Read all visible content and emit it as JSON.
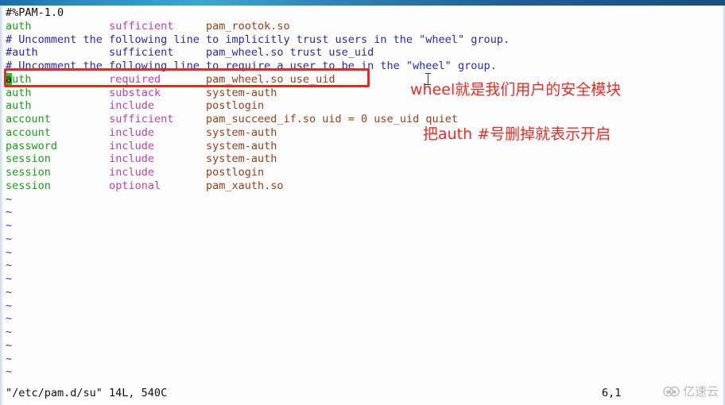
{
  "window": {
    "titlebar_color": "#1f5f96",
    "background": "#fdfdfd"
  },
  "editor": {
    "name": "vim",
    "colors": {
      "directive": "#18a018",
      "control": "#c03fb0",
      "module": "#9a4018",
      "comment": "#2a2ab0",
      "plain": "#101010",
      "tilde": "#3838b8",
      "cursor_bg": "#1ec81e",
      "annotation": "#ef2b22"
    },
    "lines": [
      {
        "segments": [
          {
            "text": "#%PAM-1.0",
            "cls": "c-black"
          }
        ]
      },
      {
        "segments": [
          {
            "text": "auth",
            "cls": "c-green"
          },
          {
            "text": "            ",
            "cls": "c-black"
          },
          {
            "text": "sufficient",
            "cls": "c-magenta"
          },
          {
            "text": "     ",
            "cls": "c-black"
          },
          {
            "text": "pam_rootok.so",
            "cls": "c-brown"
          }
        ]
      },
      {
        "segments": [
          {
            "text": "# Uncomment the following line to implicitly trust users in the \"wheel\" group.",
            "cls": "c-blue"
          }
        ]
      },
      {
        "segments": [
          {
            "text": "#auth",
            "cls": "c-blue"
          },
          {
            "text": "           ",
            "cls": "c-black"
          },
          {
            "text": "sufficient",
            "cls": "c-blue"
          },
          {
            "text": "     ",
            "cls": "c-black"
          },
          {
            "text": "pam_wheel.so trust use_uid",
            "cls": "c-blue"
          }
        ]
      },
      {
        "segments": [
          {
            "text": "# Uncomment the following line to require a user to be in the \"wheel\" group.",
            "cls": "c-blue"
          }
        ]
      },
      {
        "segments": [
          {
            "text": "a",
            "cls": "cursor"
          },
          {
            "text": "uth",
            "cls": "c-green"
          },
          {
            "text": "            ",
            "cls": "c-black"
          },
          {
            "text": "required",
            "cls": "c-magenta"
          },
          {
            "text": "       ",
            "cls": "c-black"
          },
          {
            "text": "pam_wheel.so use_uid",
            "cls": "c-brown"
          }
        ]
      },
      {
        "segments": [
          {
            "text": "auth",
            "cls": "c-green"
          },
          {
            "text": "            ",
            "cls": "c-black"
          },
          {
            "text": "substack",
            "cls": "c-magenta"
          },
          {
            "text": "       ",
            "cls": "c-black"
          },
          {
            "text": "system-auth",
            "cls": "c-brown"
          }
        ]
      },
      {
        "segments": [
          {
            "text": "auth",
            "cls": "c-green"
          },
          {
            "text": "            ",
            "cls": "c-black"
          },
          {
            "text": "include",
            "cls": "c-magenta"
          },
          {
            "text": "        ",
            "cls": "c-black"
          },
          {
            "text": "postlogin",
            "cls": "c-brown"
          }
        ]
      },
      {
        "segments": [
          {
            "text": "account",
            "cls": "c-green"
          },
          {
            "text": "         ",
            "cls": "c-black"
          },
          {
            "text": "sufficient",
            "cls": "c-magenta"
          },
          {
            "text": "     ",
            "cls": "c-black"
          },
          {
            "text": "pam_succeed_if.so uid = 0 use_uid quiet",
            "cls": "c-brown"
          }
        ]
      },
      {
        "segments": [
          {
            "text": "account",
            "cls": "c-green"
          },
          {
            "text": "         ",
            "cls": "c-black"
          },
          {
            "text": "include",
            "cls": "c-magenta"
          },
          {
            "text": "        ",
            "cls": "c-black"
          },
          {
            "text": "system-auth",
            "cls": "c-brown"
          }
        ]
      },
      {
        "segments": [
          {
            "text": "password",
            "cls": "c-green"
          },
          {
            "text": "        ",
            "cls": "c-black"
          },
          {
            "text": "include",
            "cls": "c-magenta"
          },
          {
            "text": "        ",
            "cls": "c-black"
          },
          {
            "text": "system-auth",
            "cls": "c-brown"
          }
        ]
      },
      {
        "segments": [
          {
            "text": "session",
            "cls": "c-green"
          },
          {
            "text": "         ",
            "cls": "c-black"
          },
          {
            "text": "include",
            "cls": "c-magenta"
          },
          {
            "text": "        ",
            "cls": "c-black"
          },
          {
            "text": "system-auth",
            "cls": "c-brown"
          }
        ]
      },
      {
        "segments": [
          {
            "text": "session",
            "cls": "c-green"
          },
          {
            "text": "         ",
            "cls": "c-black"
          },
          {
            "text": "include",
            "cls": "c-magenta"
          },
          {
            "text": "        ",
            "cls": "c-black"
          },
          {
            "text": "postlogin",
            "cls": "c-brown"
          }
        ]
      },
      {
        "segments": [
          {
            "text": "session",
            "cls": "c-green"
          },
          {
            "text": "         ",
            "cls": "c-black"
          },
          {
            "text": "optional",
            "cls": "c-magenta"
          },
          {
            "text": "       ",
            "cls": "c-black"
          },
          {
            "text": "pam_xauth.so",
            "cls": "c-brown"
          }
        ]
      }
    ],
    "empty_marker": "~",
    "empty_marker_count": 14
  },
  "annotations": {
    "highlight_box": {
      "label": "red-rectangle-around-auth-required-line",
      "color": "#e8291c"
    },
    "notes": [
      {
        "text": "wheel就是我们用户的安全模块"
      },
      {
        "text": "把auth #号删掉就表示开启"
      }
    ]
  },
  "statusline": {
    "file_info": "\"/etc/pam.d/su\" 14L, 540C",
    "position": "6,1"
  },
  "watermark": {
    "text": "亿速云",
    "color": "#8d939b"
  }
}
